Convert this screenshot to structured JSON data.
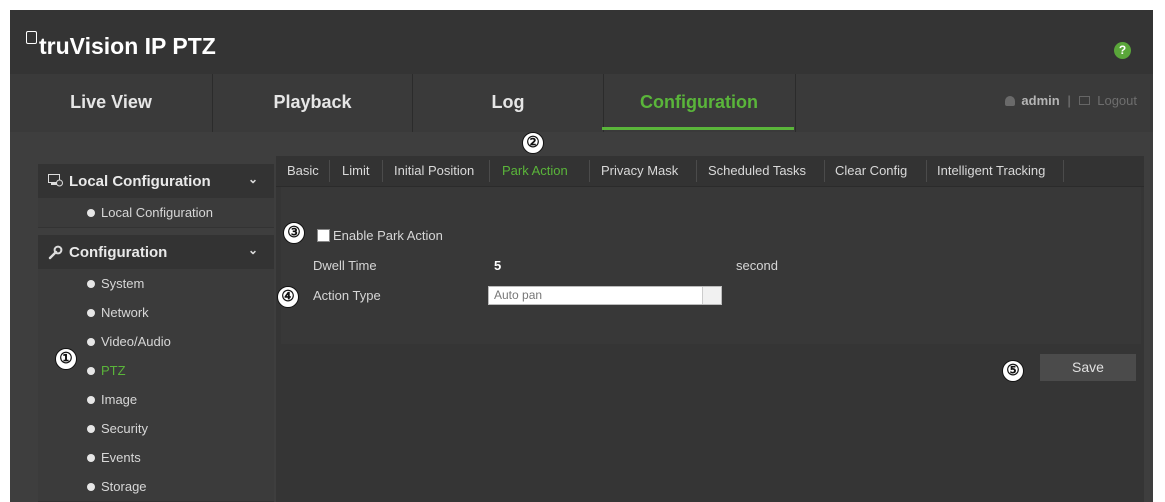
{
  "app": {
    "title": "truVision  IP PTZ"
  },
  "header": {
    "help_label": "?"
  },
  "nav": {
    "items": [
      {
        "label": "Live View",
        "active": false
      },
      {
        "label": "Playback",
        "active": false
      },
      {
        "label": "Log",
        "active": false
      },
      {
        "label": "Configuration",
        "active": true
      }
    ],
    "user": "admin",
    "logout": "Logout"
  },
  "sidebar": {
    "groups": [
      {
        "label": "Local Configuration",
        "icon": "local-config-icon",
        "items": [
          {
            "label": "Local Configuration"
          }
        ]
      },
      {
        "label": "Configuration",
        "icon": "wrench-icon",
        "items": [
          {
            "label": "System"
          },
          {
            "label": "Network"
          },
          {
            "label": "Video/Audio"
          },
          {
            "label": "PTZ",
            "active": true
          },
          {
            "label": "Image"
          },
          {
            "label": "Security"
          },
          {
            "label": "Events"
          },
          {
            "label": "Storage"
          }
        ]
      }
    ]
  },
  "tabs": [
    {
      "label": "Basic"
    },
    {
      "label": "Limit"
    },
    {
      "label": "Initial Position"
    },
    {
      "label": "Park Action",
      "active": true
    },
    {
      "label": "Privacy Mask"
    },
    {
      "label": "Scheduled Tasks"
    },
    {
      "label": "Clear Config"
    },
    {
      "label": "Intelligent Tracking"
    }
  ],
  "form": {
    "enable_label": "Enable Park Action",
    "dwell_label": "Dwell Time",
    "dwell_value": "5",
    "dwell_unit": "second",
    "action_label": "Action Type",
    "action_value": "Auto pan"
  },
  "save_label": "Save",
  "callouts": [
    "①",
    "②",
    "③",
    "④",
    "⑤"
  ],
  "colors": {
    "accent": "#5ab53a",
    "background": "#3e3e3e",
    "header": "#343434"
  }
}
